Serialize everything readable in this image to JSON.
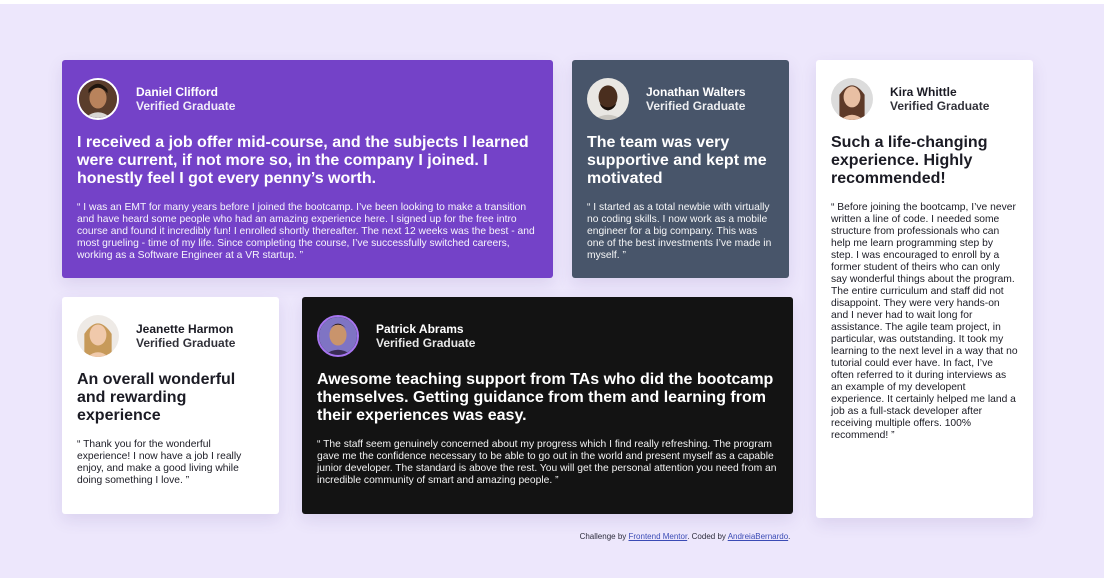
{
  "testimonials": {
    "daniel": {
      "name": "Daniel Clifford",
      "role": "Verified Graduate",
      "headline": "I received a job offer mid-course, and the subjects I learned were current, if not more so, in the company I joined. I honestly feel I got every penny’s worth.",
      "quote": "“ I was an EMT for many years before I joined the bootcamp. I’ve been looking to make a transition and have heard some people who had an amazing experience here. I signed up for the free intro course and found it incredibly fun! I enrolled shortly thereafter. The next 12 weeks was the best - and most grueling - time of my life. Since completing the course, I’ve successfully switched careers, working as a Software Engineer at a VR startup. ”"
    },
    "jonathan": {
      "name": "Jonathan Walters",
      "role": "Verified Graduate",
      "headline": "The team was very supportive and kept me motivated",
      "quote": "“ I started as a total newbie with virtually no coding skills. I now work as a mobile engineer for a big company. This was one of the best investments I’ve made in myself. ”"
    },
    "kira": {
      "name": "Kira Whittle",
      "role": "Verified Graduate",
      "headline": "Such a life-changing experience. Highly recommended!",
      "quote": "“ Before joining the bootcamp, I’ve never written a line of code. I needed some structure from professionals who can help me learn programming step by step. I was encouraged to enroll by a former student of theirs who can only say wonderful things about the program. The entire curriculum and staff did not disappoint. They were very hands-on and I never had to wait long for assistance. The agile team project, in particular, was outstanding. It took my learning to the next level in a way that no tutorial could ever have. In fact, I’ve often referred to it during interviews as an example of my developent experience. It certainly helped me land a job as a full-stack developer after receiving multiple offers. 100% recommend! ”"
    },
    "jeanette": {
      "name": "Jeanette Harmon",
      "role": "Verified Graduate",
      "headline": "An overall wonderful and rewarding experience",
      "quote": "“ Thank you for the wonderful experience! I now have a job I really enjoy, and make a good living while doing something I love. ”"
    },
    "patrick": {
      "name": "Patrick Abrams",
      "role": "Verified Graduate",
      "headline": "Awesome teaching support from TAs who did the bootcamp themselves. Getting guidance from them and learning from their experiences was easy.",
      "quote": "“ The staff seem genuinely concerned about my progress which I find really refreshing. The program gave me the confidence necessary to be able to go out in the world and present myself as a capable junior developer. The standard is above the rest. You will get the personal attention you need from an incredible community of smart and amazing people. ”"
    }
  },
  "footer": {
    "prefix": "Challenge by ",
    "challenge_link": "Frontend Mentor",
    "middle": ". Coded by ",
    "author_link": "AndreiaBernardo",
    "suffix": "."
  },
  "colors": {
    "background": "#ede7fc",
    "purple_card": "#7442c8",
    "slate_card": "#48556a",
    "white_card": "#ffffff",
    "dark_card": "#19212e"
  }
}
